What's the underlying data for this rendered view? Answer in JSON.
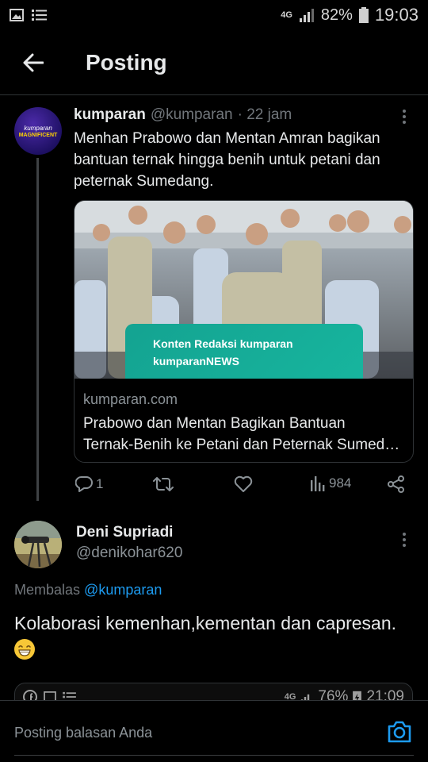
{
  "status_bar": {
    "network": "4G",
    "battery": "82%",
    "time": "19:03",
    "icons": [
      "gallery-icon",
      "list-icon",
      "signal-icon",
      "battery-icon"
    ]
  },
  "header": {
    "title": "Posting"
  },
  "tweet": {
    "name": "kumparan",
    "handle": "@kumparan",
    "time": "· 22 jam",
    "avatar_text_1": "kumparan",
    "avatar_text_2": "MAGNIFICENT",
    "text": "Menhan Prabowo dan Mentan Amran bagikan bantuan ternak hingga benih untuk petani dan peternak Sumedang.",
    "card": {
      "badge_line1": "Konten Redaksi kumparan",
      "badge_line2": "kumparanNEWS",
      "domain": "kumparan.com",
      "title_line1": "Prabowo dan Mentan Bagikan Bantuan",
      "title_line2": "Ternak-Benih ke Petani dan Peternak Sumedang"
    },
    "actions": {
      "replies": "1",
      "retweets": "",
      "likes": "",
      "views": "984"
    }
  },
  "reply": {
    "name": "Deni Supriadi",
    "handle": "@denikohar620",
    "replying_label": "Membalas",
    "replying_to": "@kumparan",
    "text": "Kolaborasi kemenhan,kementan dan capresan."
  },
  "embedded_status": {
    "network": "4G",
    "battery": "76%",
    "time": "21:09"
  },
  "composer": {
    "placeholder": "Posting balasan Anda"
  },
  "colors": {
    "background": "#000000",
    "accent": "#1d9bf0",
    "muted": "#71767b",
    "badge": "#17b59e"
  }
}
